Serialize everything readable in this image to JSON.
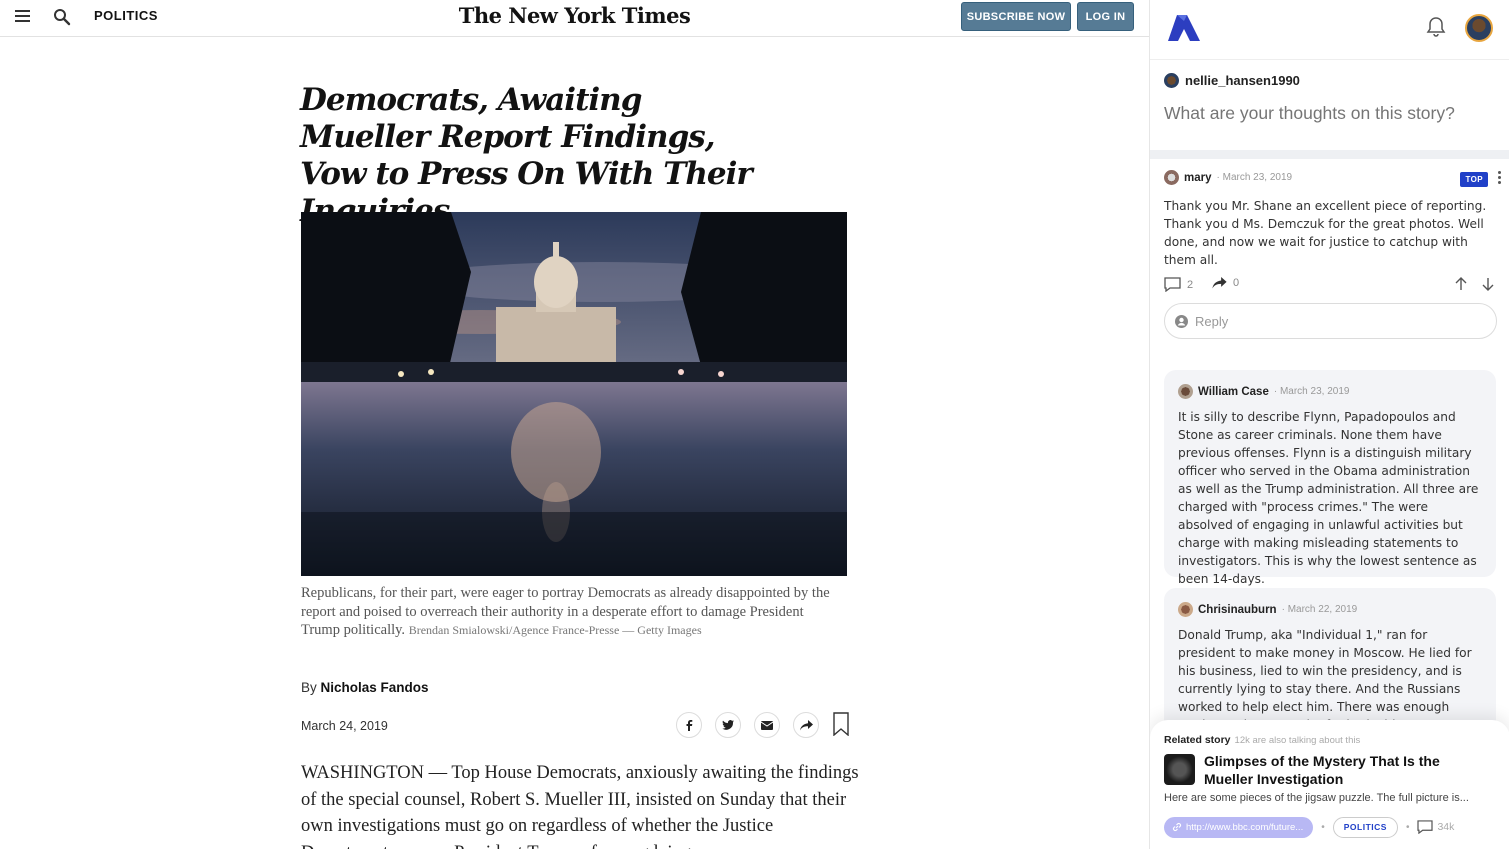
{
  "nyt": {
    "section": "POLITICS",
    "masthead": "The New York Times",
    "subscribe_label": "SUBSCRIBE NOW",
    "login_label": "LOG IN",
    "headline": "Democrats, Awaiting Mueller Report Findings, Vow to Press On With Their Inquiries",
    "caption": "Republicans, for their part, were eager to portray Democrats as already disappointed by the report and poised to overreach their authority in a desperate effort to damage President Trump politically.",
    "caption_credit": "Brendan Smialowski/Agence France-Presse — Getty Images",
    "byline_prefix": "By",
    "author": "Nicholas Fandos",
    "date": "March 24, 2019",
    "body": "WASHINGTON — Top House Democrats, anxiously awaiting the findings of the special counsel, Robert S. Mueller III, insisted on Sunday that their own investigations must go on regardless of whether the Justice Department accuses President Trump of wrongdoing."
  },
  "panel": {
    "username": "nellie_hansen1990",
    "prompt_placeholder": "What are your thoughts on this story?",
    "reply_placeholder": "Reply",
    "top_comment": {
      "author": "mary",
      "date": "March 23, 2019",
      "badge": "TOP",
      "text": "Thank you Mr. Shane an excellent piece of reporting. Thank you d Ms. Demczuk for the great photos. Well done, and now we wait for justice to catchup with them all.",
      "replies": "2",
      "shares": "0"
    },
    "comments": [
      {
        "author": "William Case",
        "date": "March 23, 2019",
        "text": "It is silly to describe Flynn, Papadopoulos and Stone as career criminals. None them have previous offenses. Flynn is a distinguish military officer who served in the Obama administration as well as the Trump administration. All three are charged with \"process crimes.\" The were absolved of engaging in unlawful activities but charge with making misleading statements to investigators. This is why the lowest sentence as been 14-days."
      },
      {
        "author": "Chrisinauburn",
        "date": "March 22, 2019",
        "text": "Donald Trump, aka \"Individual 1,\" ran for president to make money in Moscow. He lied for his business, lied to win the presidency, and is currently lying to stay there. And the Russians worked to help elect him. There was enough motive and opportunity for both sides."
      }
    ],
    "related": {
      "label": "Related story",
      "talking": "12k are also talking about this",
      "title": "Glimpses of the Mystery That Is the Mueller Investigation",
      "description": "Here are some pieces of the jigsaw puzzle. The full picture is...",
      "url": "http://www.bbc.com/future...",
      "tag": "POLITICS",
      "comment_count": "34k"
    }
  },
  "colors": {
    "nyt_button": "#567b95",
    "badge_blue": "#2040c8",
    "url_pill": "#b8b8f4",
    "card_bg": "#f3f4f7"
  },
  "icons": [
    "menu-icon",
    "search-icon",
    "bell-icon",
    "facebook-icon",
    "twitter-icon",
    "email-icon",
    "share-icon",
    "bookmark-icon",
    "comment-icon",
    "upvote-icon",
    "downvote-icon",
    "link-icon",
    "user-icon"
  ]
}
